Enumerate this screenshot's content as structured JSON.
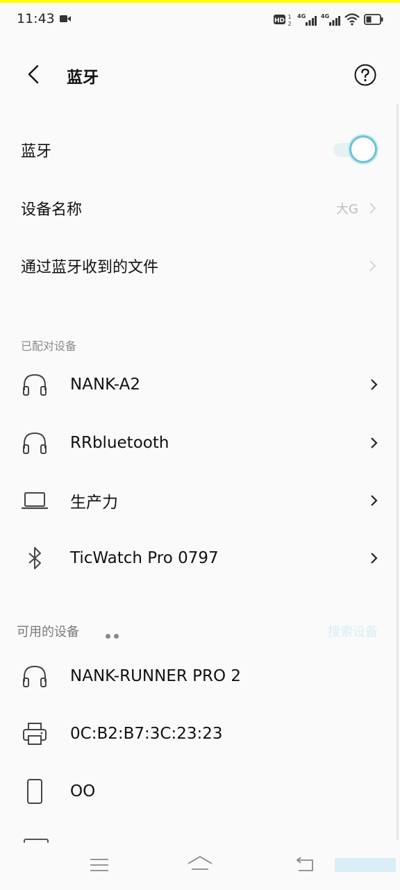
{
  "status_bar": {
    "time": "11:43"
  },
  "header": {
    "title": "蓝牙"
  },
  "settings": {
    "bluetooth_label": "蓝牙",
    "bluetooth_on": true,
    "device_name_label": "设备名称",
    "device_name_value": "大G",
    "received_files_label": "通过蓝牙收到的文件"
  },
  "paired": {
    "section_title": "已配对设备",
    "devices": [
      {
        "name": "NANK-A2",
        "icon": "headphones-icon"
      },
      {
        "name": "RRbluetooth",
        "icon": "headphones-icon"
      },
      {
        "name": "生产力",
        "icon": "laptop-icon"
      },
      {
        "name": "TicWatch Pro 0797",
        "icon": "bluetooth-icon"
      }
    ]
  },
  "available": {
    "section_title": "可用的设备",
    "search_label": "搜索设备",
    "devices": [
      {
        "name": "NANK-RUNNER PRO 2",
        "icon": "headphones-icon"
      },
      {
        "name": "0C:B2:B7:3C:23:23",
        "icon": "printer-icon"
      },
      {
        "name": "OO",
        "icon": "phone-icon"
      }
    ]
  },
  "colors": {
    "accent": "#6ac2d6",
    "top_line": "#ffff00"
  }
}
